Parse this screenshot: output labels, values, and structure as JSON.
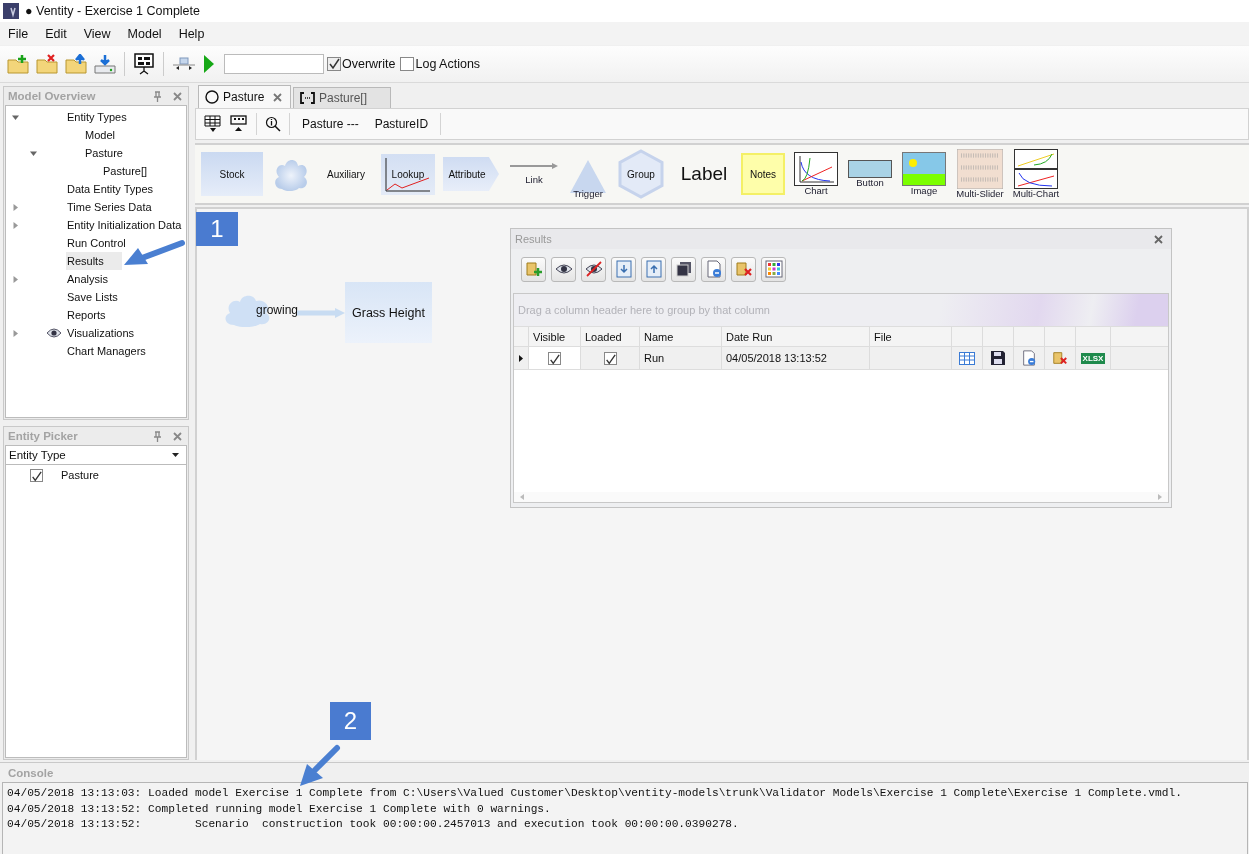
{
  "window": {
    "title": "● Ventity - Exercise 1 Complete"
  },
  "menu": [
    "File",
    "Edit",
    "View",
    "Model",
    "Help"
  ],
  "toolbar": {
    "options": [
      {
        "label": "Overwrite",
        "checked": true
      },
      {
        "label": "Log Actions",
        "checked": false
      }
    ]
  },
  "model_overview": {
    "title": "Model Overview",
    "tree": [
      {
        "label": "Entity Types",
        "kind": "entry",
        "expanded": true,
        "selected": false,
        "children": [
          {
            "label": "Model",
            "kind": "entry",
            "selected": false
          },
          {
            "label": "Pasture",
            "kind": "entry",
            "expanded": true,
            "selected": false,
            "children": [
              {
                "label": "Pasture[]",
                "kind": "entry",
                "selected": false
              }
            ]
          }
        ]
      },
      {
        "label": "Data Entity Types",
        "kind": "entry",
        "selected": false
      },
      {
        "label": "Time Series Data",
        "kind": "entry",
        "expanded": false,
        "selected": false
      },
      {
        "label": "Entity Initialization Data",
        "kind": "entry",
        "expanded": false,
        "selected": false
      },
      {
        "label": "Run Control",
        "kind": "entry",
        "selected": false
      },
      {
        "label": "Results",
        "kind": "entry",
        "selected": true
      },
      {
        "label": "Analysis",
        "kind": "entry",
        "expanded": false,
        "selected": false
      },
      {
        "label": "Save Lists",
        "kind": "entry",
        "selected": false
      },
      {
        "label": "Reports",
        "kind": "entry",
        "selected": false
      },
      {
        "label": "Visualizations",
        "kind": "view",
        "expanded": false,
        "selected": false
      },
      {
        "label": "Chart Managers",
        "kind": "entry",
        "selected": false
      }
    ]
  },
  "entity_picker": {
    "title": "Entity Picker",
    "dropdown": "Entity Type",
    "items": [
      {
        "label": "Pasture",
        "checked": true
      }
    ]
  },
  "tabs": [
    {
      "label": "Pasture",
      "kind": "entity",
      "selected": true
    },
    {
      "label": "Pasture[]",
      "kind": "collection",
      "selected": false
    }
  ],
  "subtoolbar": {
    "labels": [
      "Pasture ---",
      "PastureID"
    ]
  },
  "palette": [
    {
      "kind": "stock",
      "label": "Stock"
    },
    {
      "kind": "cloud"
    },
    {
      "kind": "auxiliary",
      "label": "Auxiliary"
    },
    {
      "kind": "lookup",
      "label": "Lookup"
    },
    {
      "kind": "attribute",
      "label": "Attribute"
    },
    {
      "kind": "link",
      "label": "Link"
    },
    {
      "kind": "trigger",
      "label": "Trigger"
    },
    {
      "kind": "group",
      "label": "Group"
    },
    {
      "kind": "label",
      "label": "Label"
    },
    {
      "kind": "notes",
      "label": "Notes"
    },
    {
      "kind": "chart",
      "label": "Chart"
    },
    {
      "kind": "button",
      "label": "Button"
    },
    {
      "kind": "image",
      "label": "Image"
    },
    {
      "kind": "multislider",
      "label": "Multi-Slider"
    },
    {
      "kind": "multichart",
      "label": "Multi-Chart"
    }
  ],
  "canvas": {
    "nodes": [
      {
        "kind": "cloud",
        "label": "growing"
      },
      {
        "kind": "stock",
        "label": "Grass Height"
      }
    ]
  },
  "results": {
    "title": "Results",
    "group_hint": "Drag a column header here to group by that column",
    "columns": [
      "Visible",
      "Loaded",
      "Name",
      "Date Run",
      "File"
    ],
    "rows": [
      {
        "visible": true,
        "loaded": true,
        "name": "Run",
        "date_run": "04/05/2018 13:13:52",
        "export_label": "XLSX"
      }
    ]
  },
  "callouts": [
    "1",
    "2"
  ],
  "console": {
    "title": "Console",
    "lines": [
      "04/05/2018 13:13:03: Loaded model Exercise 1 Complete from C:\\Users\\Valued Customer\\Desktop\\ventity-models\\trunk\\Validator Models\\Exercise 1 Complete\\Exercise 1 Complete.vmdl.",
      "04/05/2018 13:13:52: Completed running model Exercise 1 Complete with 0 warnings.",
      "04/05/2018 13:13:52:        Scenario  construction took 00:00:00.2457013 and execution took 00:00:00.0390278."
    ]
  }
}
